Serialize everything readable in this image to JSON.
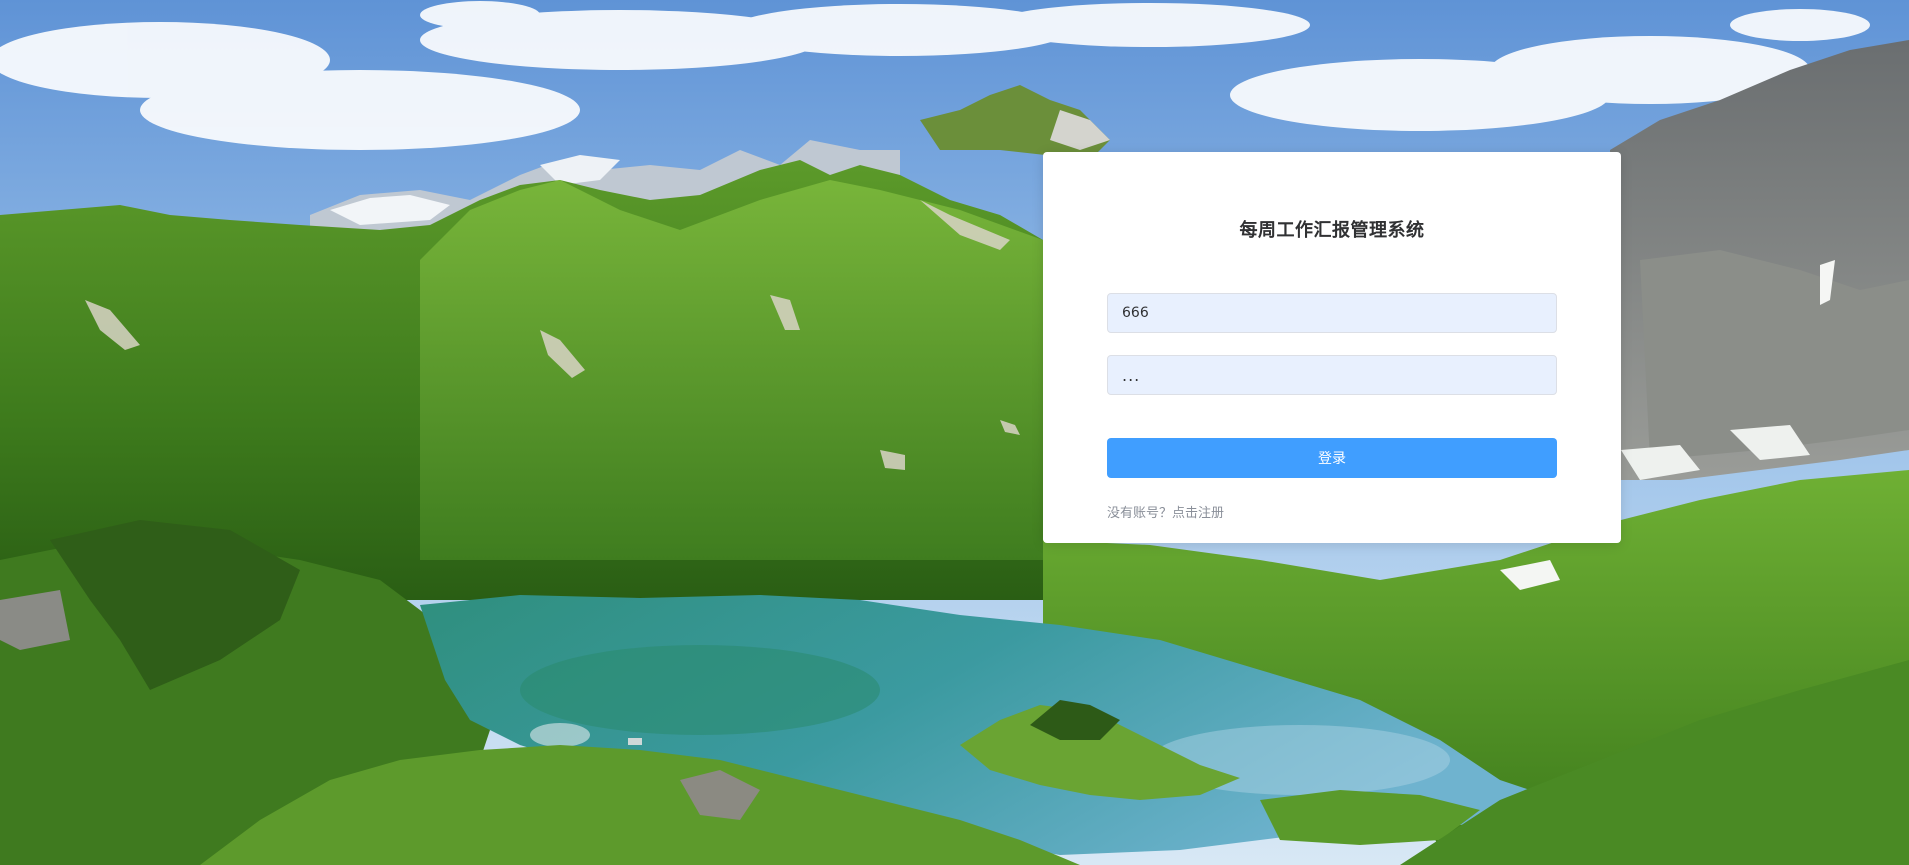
{
  "login": {
    "title": "每周工作汇报管理系统",
    "username_value": "666",
    "password_value": "...",
    "submit_label": "登录",
    "register_link": "没有账号？点击注册"
  },
  "colors": {
    "primary": "#409eff",
    "input_autofill_bg": "#e8f0fe",
    "card_bg": "#ffffff"
  }
}
